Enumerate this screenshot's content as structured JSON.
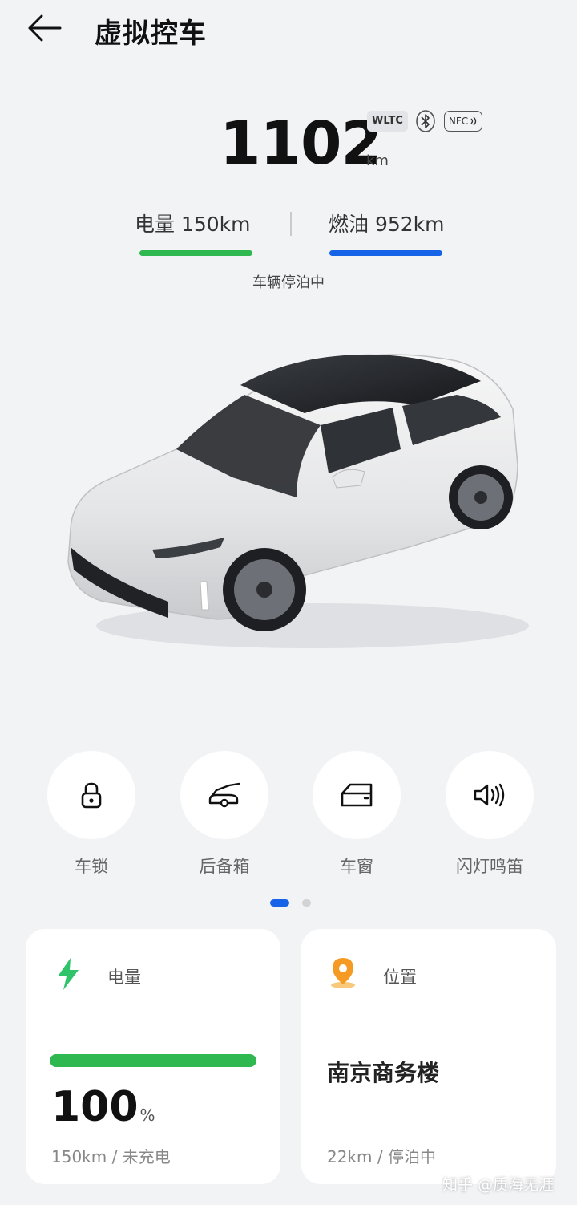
{
  "header": {
    "title": "虚拟控车",
    "back_icon": "arrow-left-icon"
  },
  "range": {
    "value": "1102",
    "unit": "km",
    "standard_badge": "WLTC",
    "nfc_badge": "NFC"
  },
  "energy": {
    "battery_label": "电量 150km",
    "fuel_label": "燃油 952km",
    "battery_color": "#2fb84f",
    "fuel_color": "#1763e8"
  },
  "vehicle_status": "车辆停泊中",
  "actions": [
    {
      "label": "车锁",
      "icon": "lock-icon"
    },
    {
      "label": "后备箱",
      "icon": "trunk-icon"
    },
    {
      "label": "车窗",
      "icon": "window-icon"
    },
    {
      "label": "闪灯鸣笛",
      "icon": "horn-icon"
    }
  ],
  "pager": {
    "total": 2,
    "active": 1
  },
  "battery_card": {
    "title": "电量",
    "level_percent": 100,
    "value": "100",
    "unit": "%",
    "subtext": "150km / 未充电"
  },
  "location_card": {
    "title": "位置",
    "place": "南京商务楼",
    "subtext": "22km / 停泊中"
  },
  "watermark": "知乎 @质海无涯"
}
